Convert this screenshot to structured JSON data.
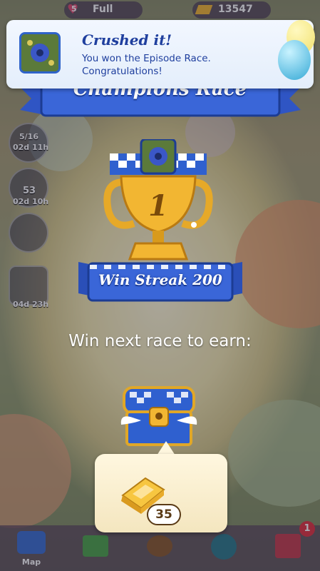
{
  "toast": {
    "title": "Crushed it!",
    "message": "You won the Episode Race. Congratulations!"
  },
  "banner": {
    "title": "Champions Race"
  },
  "trophy": {
    "place": "1"
  },
  "streak": {
    "label": "Win Streak 200"
  },
  "reward": {
    "prompt": "Win next race to earn:",
    "item_icon": "gold-bar-icon",
    "count": "35"
  },
  "sidebar": [
    {
      "label": "5/16",
      "sub": "02d 11h"
    },
    {
      "label": "53",
      "sub": "02d 10h"
    },
    {
      "label": "",
      "sub": ""
    },
    {
      "label": "",
      "sub": "04d 23h"
    }
  ],
  "topbar": {
    "lives": "5",
    "lives_status": "Full",
    "score": "13547"
  },
  "nav": {
    "map_label": "Map",
    "badge": "1"
  },
  "colors": {
    "accent_blue": "#1f3f9e",
    "gold": "#f2b632"
  }
}
